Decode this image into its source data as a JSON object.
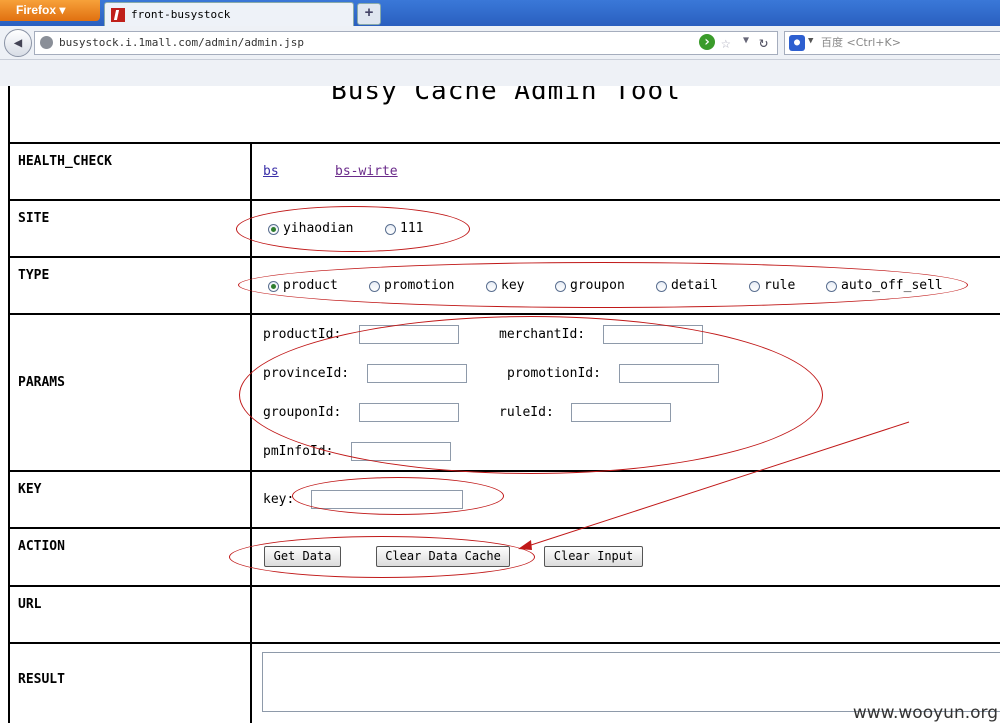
{
  "browser": {
    "menu_button": "Firefox",
    "tab_title": "front-busystock",
    "new_tab": "+",
    "url": "busystock.i.1mall.com/admin/admin.jsp",
    "search_placeholder": "百度 <Ctrl+K>"
  },
  "page": {
    "title": "Busy Cache Admin Tool",
    "rows": {
      "health_check": {
        "label": "HEALTH_CHECK",
        "links": [
          "bs",
          "bs-wirte"
        ]
      },
      "site": {
        "label": "SITE",
        "options": [
          "yihaodian",
          "111"
        ],
        "selected": "yihaodian"
      },
      "type": {
        "label": "TYPE",
        "options": [
          "product",
          "promotion",
          "key",
          "groupon",
          "detail",
          "rule",
          "auto_off_sell"
        ],
        "selected": "product"
      },
      "params": {
        "label": "PARAMS",
        "fields": [
          "productId:",
          "merchantId:",
          "provinceId:",
          "promotionId:",
          "grouponId:",
          "ruleId:",
          "pmInfoId:"
        ]
      },
      "key": {
        "label": "KEY",
        "field": "key:"
      },
      "action": {
        "label": "ACTION",
        "buttons": [
          "Get Data",
          "Clear Data Cache",
          "Clear Input"
        ]
      },
      "url": {
        "label": "URL"
      },
      "result": {
        "label": "RESULT"
      }
    }
  },
  "watermark": "www.wooyun.org",
  "colors": {
    "annotation": "#c01818",
    "link": "#3a2fa8",
    "visited_link": "#6a2a8a",
    "tabbar": "#2a5fbf"
  }
}
